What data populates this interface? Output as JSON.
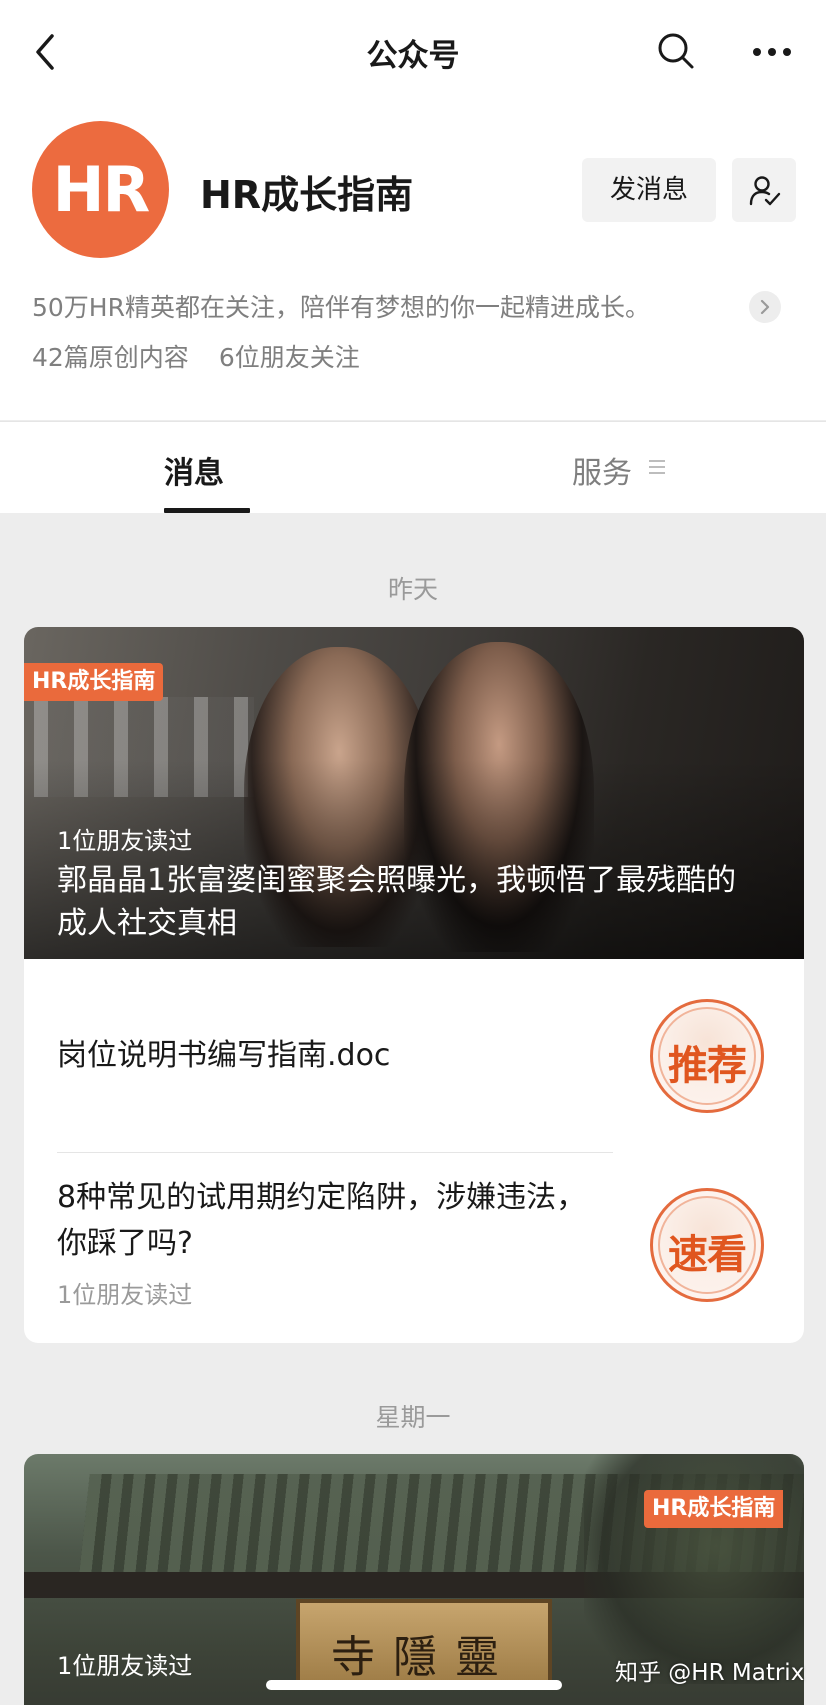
{
  "nav": {
    "title": "公众号",
    "back_icon": "chevron-left-icon",
    "search_icon": "search-icon",
    "more_icon": "more-horizontal-icon"
  },
  "account": {
    "avatar_text": "HR",
    "name": "HR成长指南",
    "send_message_label": "发消息",
    "follow_icon": "user-check-icon",
    "description": "50万HR精英都在关注，陪伴有梦想的你一起精进成长。",
    "original_count": "42篇原创内容",
    "friends_following": "6位朋友关注"
  },
  "tabs": {
    "messages": "消息",
    "services": "服务"
  },
  "groups": [
    {
      "date": "昨天",
      "hero": {
        "brand_tag": "HR成长指南",
        "read_by": "1位朋友读过",
        "title": "郭晶晶1张富婆闺蜜聚会照曝光，我顿悟了最残酷的成人社交真相"
      },
      "items": [
        {
          "title": "岗位说明书编写指南.doc",
          "badge": "推荐",
          "read_by": ""
        },
        {
          "title": "8种常见的试用期约定陷阱，涉嫌违法，你踩了吗?",
          "badge": "速看",
          "read_by": "1位朋友读过"
        }
      ]
    },
    {
      "date": "星期一",
      "hero": {
        "brand_tag": "HR成长指南",
        "read_by": "1位朋友读过",
        "plaque": "寺隱靈"
      }
    }
  ],
  "watermark": "知乎 @HR Matrix",
  "colors": {
    "brand_orange": "#ec6b3f",
    "badge_orange": "#e0561f",
    "background": "#ededed"
  }
}
